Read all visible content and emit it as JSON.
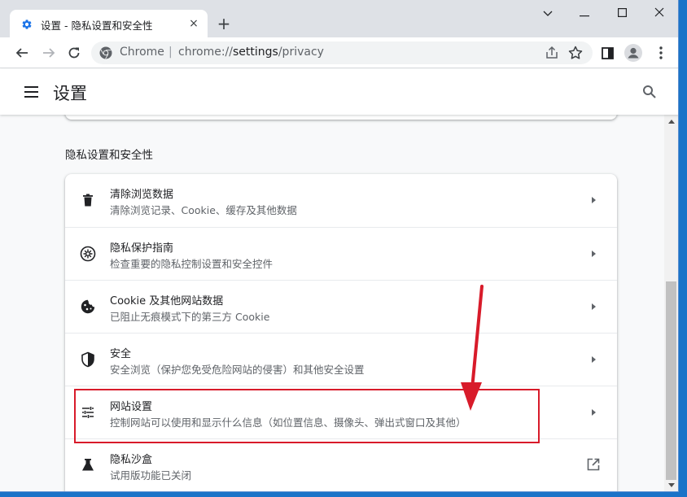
{
  "browser": {
    "tab_title": "设置 - 隐私设置和安全性",
    "tab_close": "×",
    "new_tab": "+",
    "window_controls": {
      "minimize": "—",
      "maximize": "☐",
      "close": "✕"
    },
    "omnibox": {
      "site_label": "Chrome",
      "separator": "|",
      "url_scheme": "chrome://",
      "url_host": "settings",
      "url_path": "/privacy"
    }
  },
  "settings": {
    "title": "设置",
    "section_title": "隐私设置和安全性",
    "rows": [
      {
        "title": "清除浏览数据",
        "subtitle": "清除浏览记录、Cookie、缓存及其他数据",
        "icon": "trash-icon"
      },
      {
        "title": "隐私保护指南",
        "subtitle": "检查重要的隐私控制设置和安全控件",
        "icon": "privacy-guide-icon"
      },
      {
        "title": "Cookie 及其他网站数据",
        "subtitle": "已阻止无痕模式下的第三方 Cookie",
        "icon": "cookie-icon"
      },
      {
        "title": "安全",
        "subtitle": "安全浏览（保护您免受危险网站的侵害）和其他安全设置",
        "icon": "shield-icon"
      },
      {
        "title": "网站设置",
        "subtitle": "控制网站可以使用和显示什么信息（如位置信息、摄像头、弹出式窗口及其他）",
        "icon": "tune-icon"
      },
      {
        "title": "隐私沙盒",
        "subtitle": "试用版功能已关闭",
        "icon": "flask-icon"
      }
    ]
  },
  "colors": {
    "annotation_red": "#d81b2a",
    "accent_blue": "#1a73e8"
  }
}
